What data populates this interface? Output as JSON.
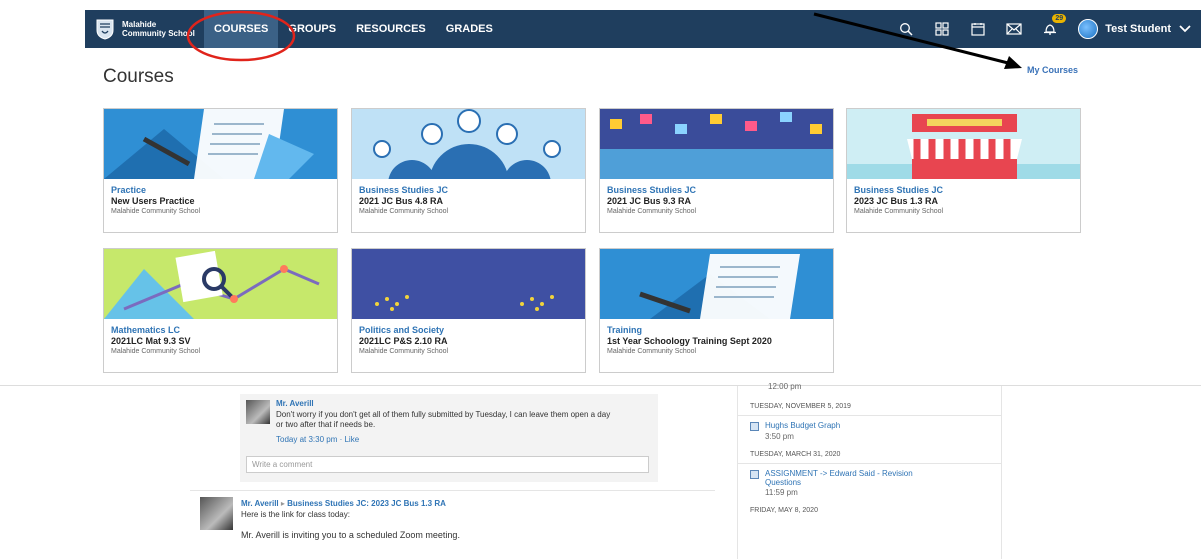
{
  "nav": {
    "school_line1": "Malahide",
    "school_line2": "Community School",
    "links": [
      "COURSES",
      "GROUPS",
      "RESOURCES",
      "GRADES"
    ],
    "notification_count": "29",
    "user_name": "Test Student"
  },
  "page": {
    "title": "Courses",
    "my_courses": "My Courses"
  },
  "courses": [
    {
      "category": "Practice",
      "name": "New Users Practice",
      "school": "Malahide Community School"
    },
    {
      "category": "Business Studies JC",
      "name": "2021 JC Bus 4.8 RA",
      "school": "Malahide Community School"
    },
    {
      "category": "Business Studies JC",
      "name": "2021 JC Bus 9.3 RA",
      "school": "Malahide Community School"
    },
    {
      "category": "Business Studies JC",
      "name": "2023 JC Bus 1.3 RA",
      "school": "Malahide Community School"
    },
    {
      "category": "Mathematics LC",
      "name": "2021LC Mat 9.3 SV",
      "school": "Malahide Community School"
    },
    {
      "category": "Politics and Society",
      "name": "2021LC P&S 2.10 RA",
      "school": "Malahide Community School"
    },
    {
      "category": "Training",
      "name": "1st Year Schoology Training Sept 2020",
      "school": "Malahide Community School"
    }
  ],
  "feed": {
    "comment_author": "Mr. Averill",
    "comment_text_1": "Don't worry if you don't get all of them fully submitted by Tuesday, I can leave them open a day",
    "comment_text_2": "or two after that if needs be.",
    "comment_meta": "Today at 3:30 pm · Like",
    "write_comment_placeholder": "Write a comment",
    "post_author": "Mr. Averill",
    "post_arrow": "▸",
    "post_target": "Business Studies JC: 2023 JC Bus 1.3 RA",
    "post_text_1": "Here is the link for class today:",
    "post_text_2": "Mr. Averill is inviting you to a scheduled Zoom meeting."
  },
  "calendar": {
    "partial_time": "12:00 pm",
    "date1": "TUESDAY, NOVEMBER 5, 2019",
    "item1_title": "Hughs Budget Graph",
    "item1_time": "3:50 pm",
    "date2": "TUESDAY, MARCH 31, 2020",
    "item2_title_1": "ASSIGNMENT -> Edward Said - Revision",
    "item2_title_2": "Questions",
    "item2_time": "11:59 pm",
    "date3": "FRIDAY, MAY 8, 2020"
  },
  "colors": {
    "nav_bg": "#1f3e5e",
    "nav_active": "#3b6186",
    "link_blue": "#2f74b5",
    "badge": "#e9b400",
    "annotation_red": "#e0241b"
  }
}
